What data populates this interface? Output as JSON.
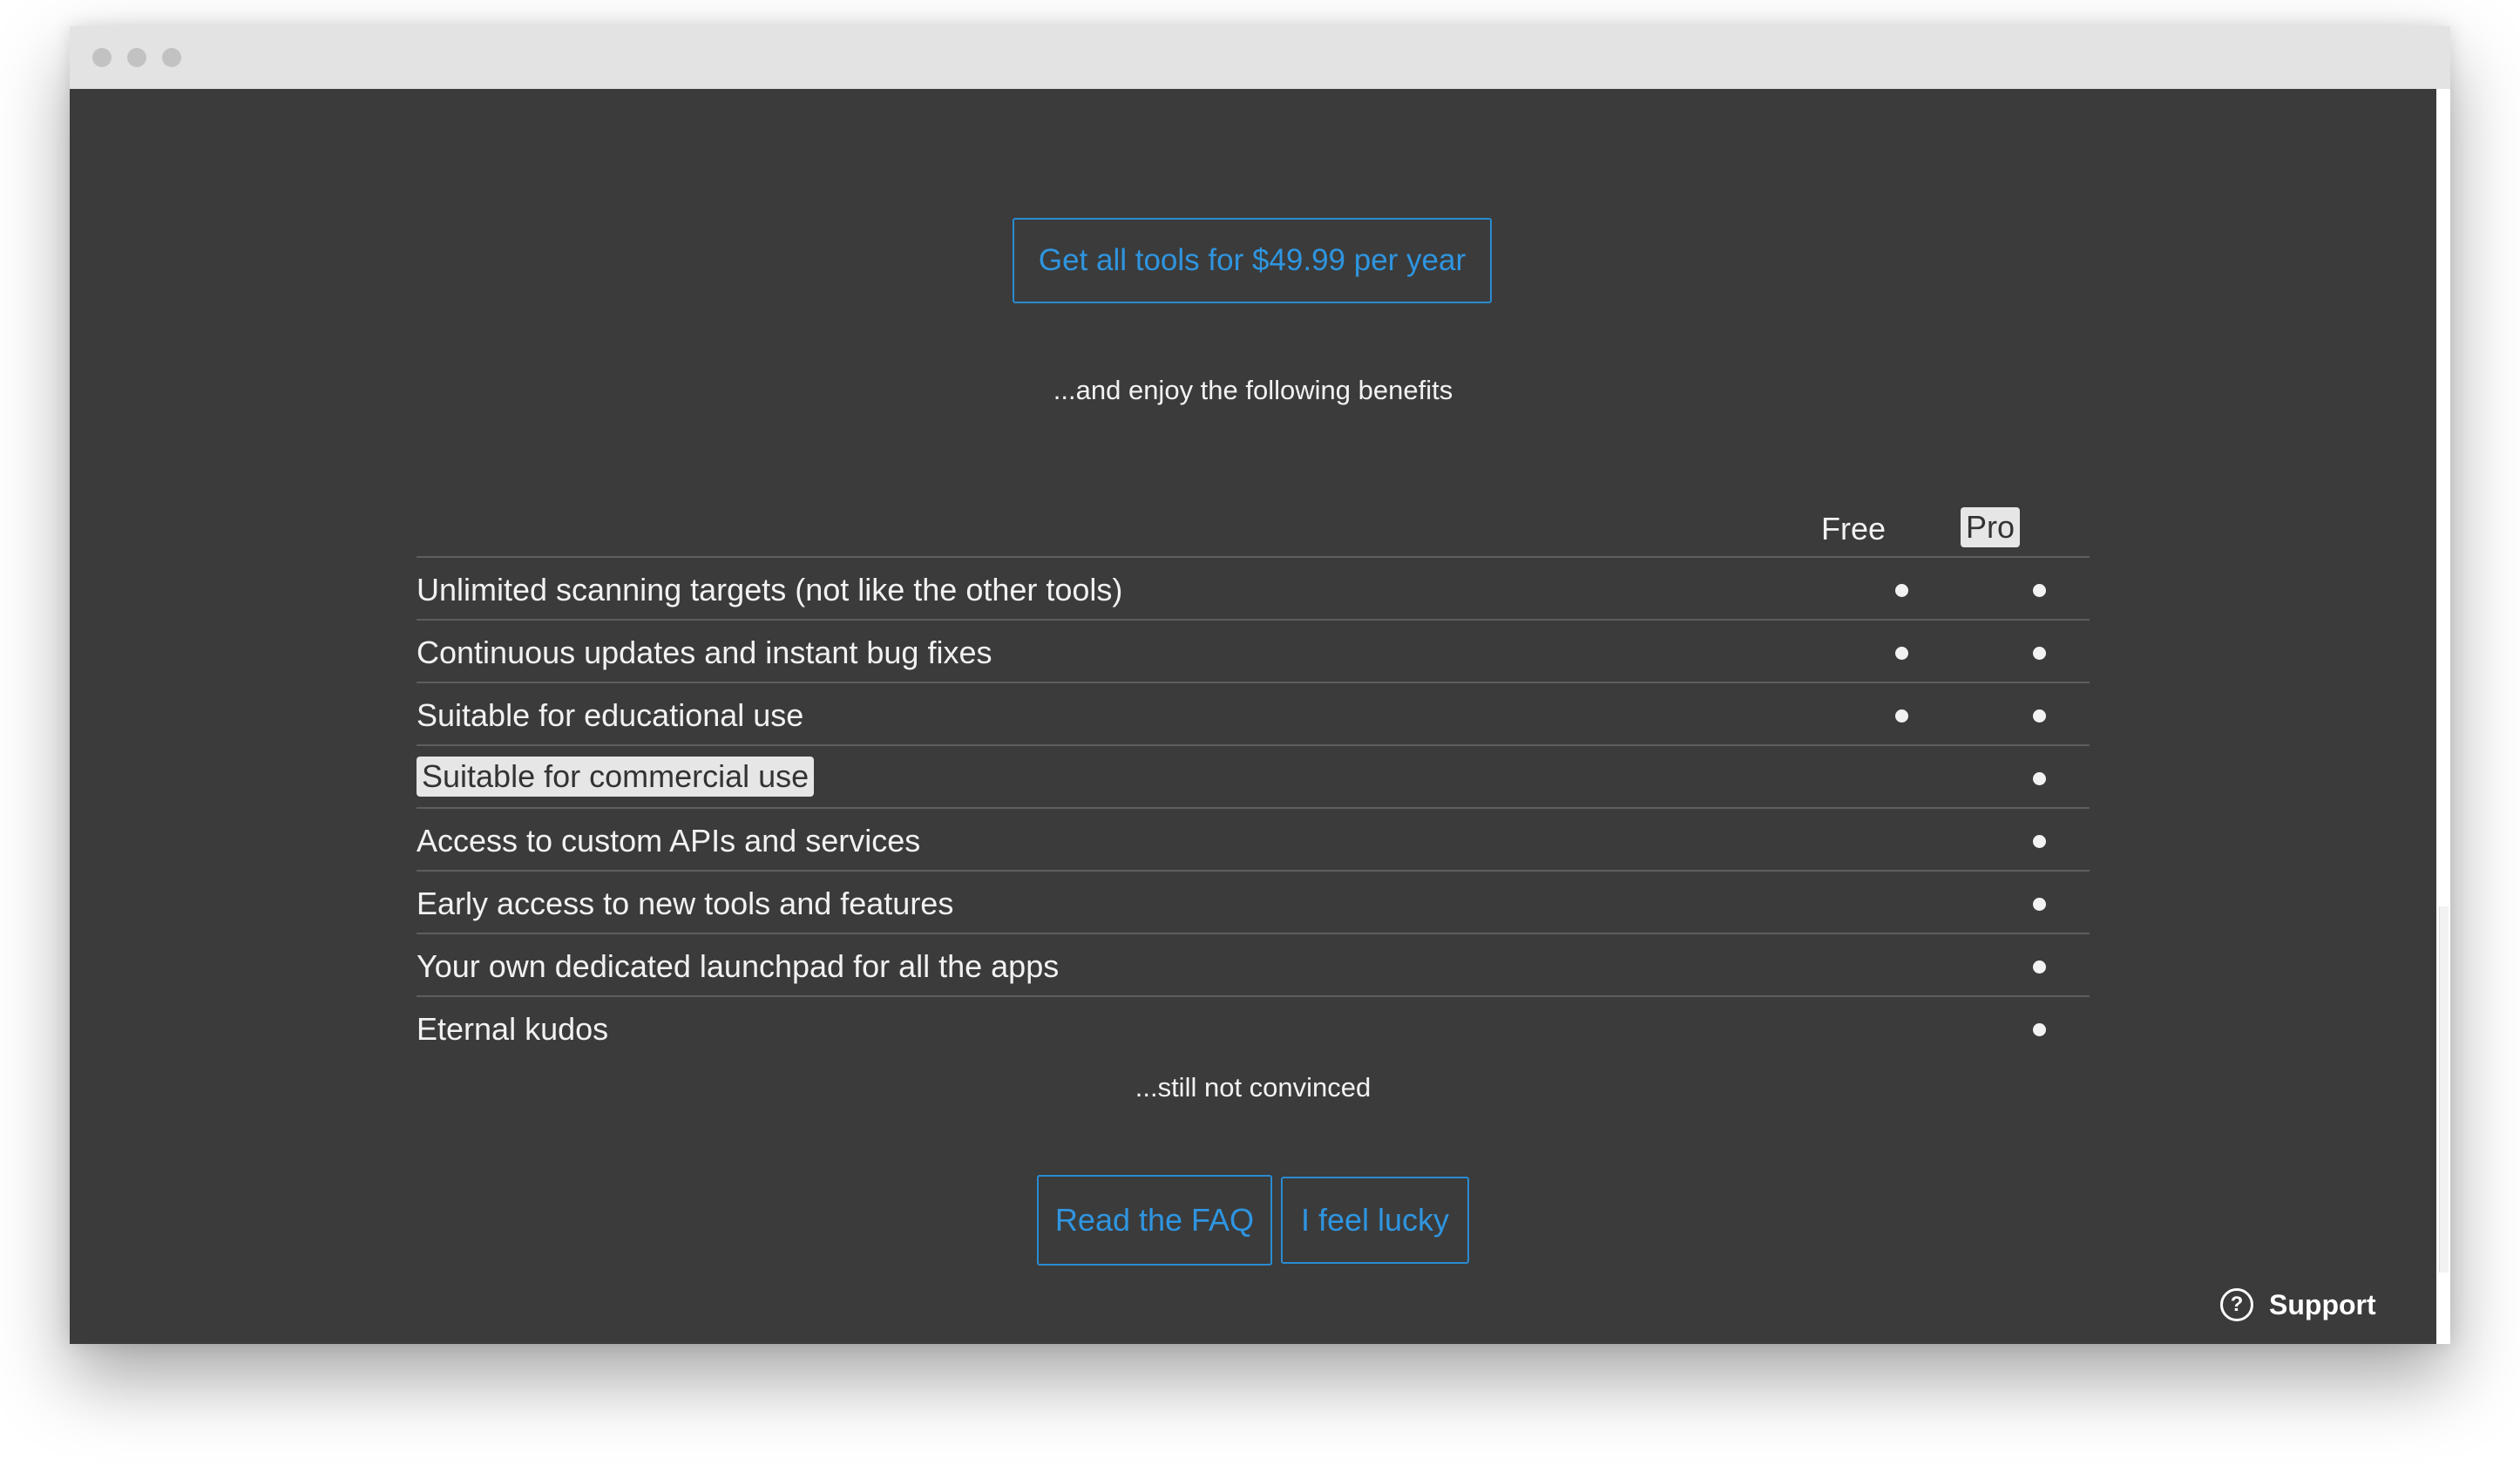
{
  "cta": {
    "label": "Get all tools for $49.99 per year"
  },
  "benefits_intro": "...and enjoy the following benefits",
  "table": {
    "columns": [
      "Free",
      "Pro"
    ],
    "rows": [
      {
        "label": "Unlimited scanning targets (not like the other tools)",
        "free": true,
        "pro": true
      },
      {
        "label": "Continuous updates and instant bug fixes",
        "free": true,
        "pro": true
      },
      {
        "label": "Suitable for educational use",
        "free": true,
        "pro": true
      },
      {
        "label": "Suitable for commercial use",
        "free": false,
        "pro": true
      },
      {
        "label": "Access to custom APIs and services",
        "free": false,
        "pro": true
      },
      {
        "label": "Early access to new tools and features",
        "free": false,
        "pro": true
      },
      {
        "label": "Your own dedicated launchpad for all the apps",
        "free": false,
        "pro": true
      },
      {
        "label": "Eternal kudos",
        "free": false,
        "pro": true
      }
    ]
  },
  "not_convinced": "...still not convinced",
  "buttons": {
    "faq": "Read the FAQ",
    "lucky": "I feel lucky"
  },
  "support": {
    "label": "Support",
    "icon": "question-circle-icon"
  },
  "colors": {
    "accent": "#2f95e0",
    "background": "#3b3b3b",
    "text": "#f2f2f2"
  }
}
